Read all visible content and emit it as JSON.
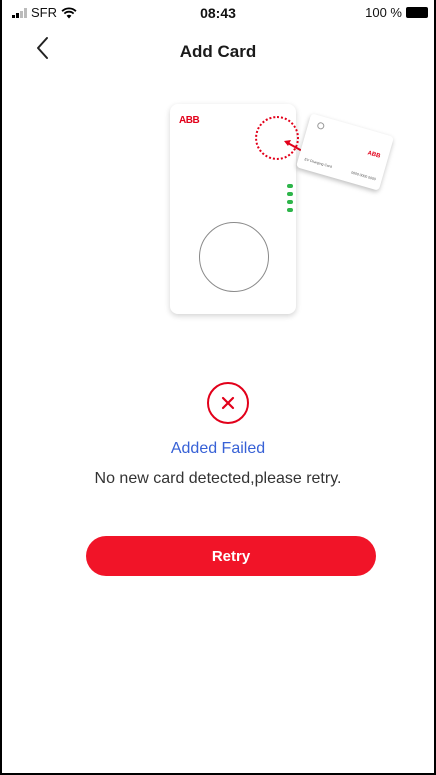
{
  "status_bar": {
    "carrier": "SFR",
    "time": "08:43",
    "battery": "100 %"
  },
  "nav": {
    "title": "Add Card",
    "back_icon": "chevron-left-icon"
  },
  "illustration": {
    "charger_logo": "ABB",
    "card_logo": "ABB",
    "card_label": "EV Charging Card",
    "card_code": "0000 0000 0000"
  },
  "result": {
    "status_icon": "error-x-icon",
    "title": "Added Failed",
    "message": "No new card detected,please retry."
  },
  "actions": {
    "retry_label": "Retry"
  },
  "colors": {
    "accent": "#f11428",
    "brand_red": "#e2001a",
    "status_title": "#3761d6",
    "led_green": "#2db54a"
  }
}
